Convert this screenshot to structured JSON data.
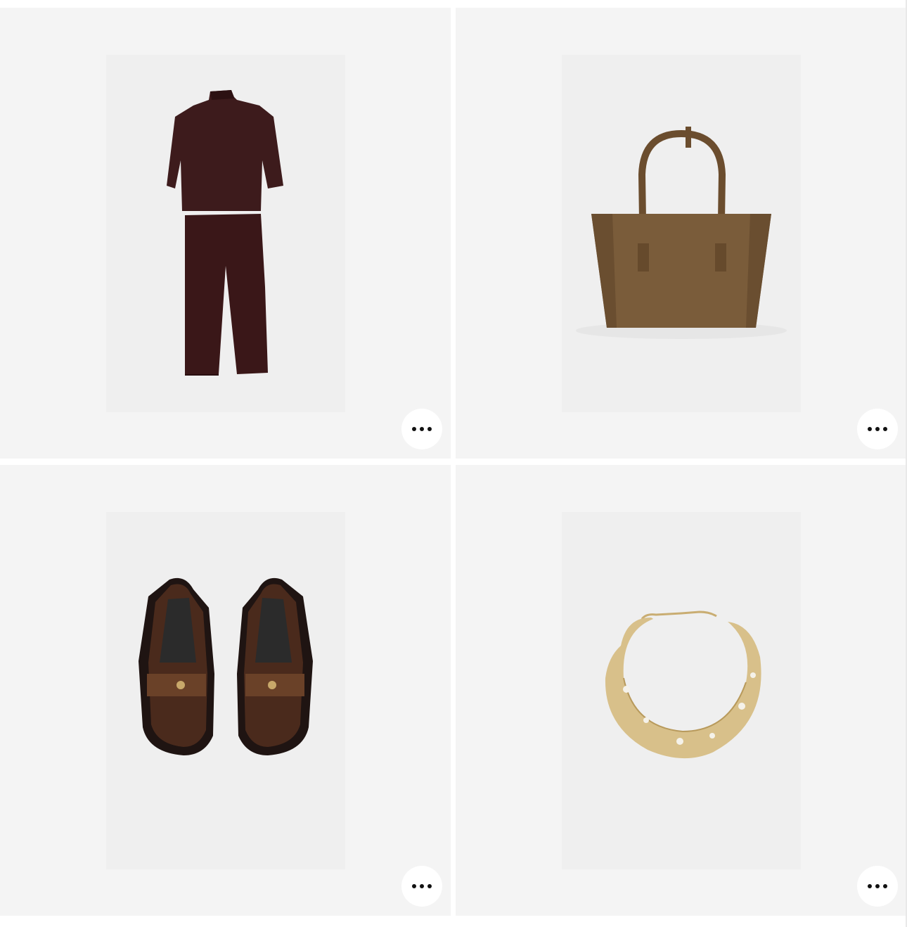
{
  "grid": {
    "products": [
      {
        "icon": "two-piece-outfit-image",
        "more_button_icon": "more-horizontal-icon"
      },
      {
        "icon": "tote-bag-image",
        "more_button_icon": "more-horizontal-icon"
      },
      {
        "icon": "penny-loafers-image",
        "more_button_icon": "more-horizontal-icon"
      },
      {
        "icon": "gold-collar-necklace-image",
        "more_button_icon": "more-horizontal-icon"
      }
    ]
  },
  "colors": {
    "tile_background": "#f4f4f4",
    "photo_background": "#efefef",
    "outfit": "#3b1a1a",
    "bag": "#7a5c3a",
    "loafer": "#4a2a1c",
    "necklace": "#d8c08a"
  }
}
